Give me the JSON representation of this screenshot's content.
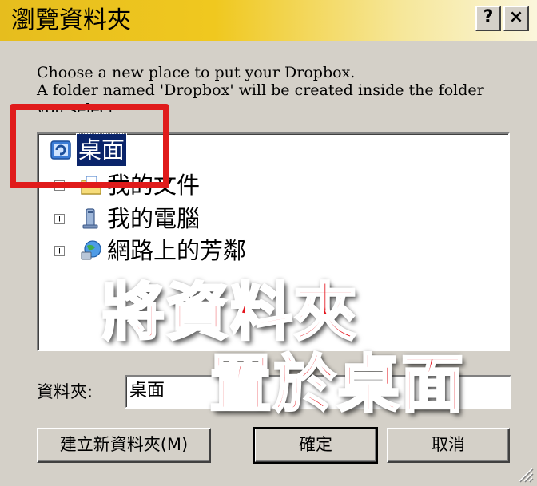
{
  "window": {
    "title": "瀏覽資料夾",
    "help_button": "?",
    "close_button": "×"
  },
  "description": {
    "line1": "Choose a new place to put your Dropbox.",
    "line2": "A folder named 'Dropbox' will be created inside the folder",
    "line3": "you select."
  },
  "tree": {
    "items": [
      {
        "label": "桌面",
        "icon": "desktop-icon",
        "selected": true
      },
      {
        "label": "我的文件",
        "icon": "my-documents-icon"
      },
      {
        "label": "我的電腦",
        "icon": "my-computer-icon"
      },
      {
        "label": "網路上的芳鄰",
        "icon": "network-places-icon"
      }
    ]
  },
  "folder_field": {
    "label": "資料夾:",
    "value": "桌面"
  },
  "buttons": {
    "new_folder": "建立新資料夾(M)",
    "ok": "確定",
    "cancel": "取消"
  },
  "annotation": {
    "line1": "將資料夾",
    "line2": "置於桌面",
    "color": "#e4141d"
  }
}
